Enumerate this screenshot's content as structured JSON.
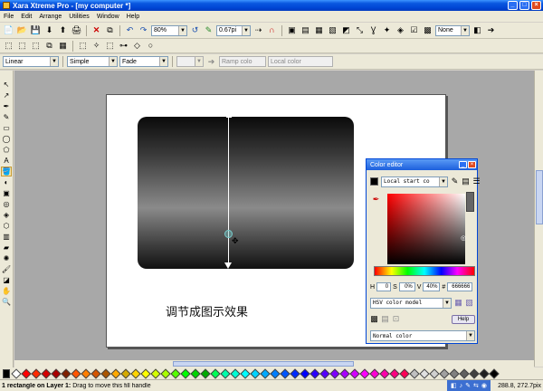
{
  "window": {
    "title": "Xara Xtreme Pro - [my computer *]"
  },
  "menu": {
    "items": [
      "File",
      "Edit",
      "Arrange",
      "Utilities",
      "Window",
      "Help"
    ]
  },
  "toolbar1": {
    "zoom_value": "80%",
    "line_width": "0.67pi",
    "line_style": "None"
  },
  "toolbar3": {
    "fill_type": "Linear",
    "fill_tiling": "Simple",
    "fill_effect": "Fade",
    "ramp_placeholder": "Ramp colo",
    "local_color_placeholder": "Local color"
  },
  "canvas": {
    "caption": "调节成图示效果"
  },
  "color_editor": {
    "title": "Color editor",
    "color_name": "Local start co",
    "h_value": "0",
    "s_value": "0%",
    "v_value": "40%",
    "hex_value": "666666",
    "model": "HSV color model",
    "help_label": "Help",
    "color_type": "Normal color",
    "labels": {
      "h": "H",
      "s": "S",
      "v": "V",
      "hash": "#"
    }
  },
  "palette": {
    "colors": [
      "#000000",
      "#ffffff",
      "#ff0000",
      "#ff2a00",
      "#d40000",
      "#aa0000",
      "#802000",
      "#ff5500",
      "#ff7f00",
      "#d45500",
      "#aa5500",
      "#ffaa00",
      "#d4aa00",
      "#ffd400",
      "#ffff00",
      "#d4ff00",
      "#aaff00",
      "#55ff00",
      "#00ff00",
      "#00d400",
      "#00aa00",
      "#00ff55",
      "#00ffaa",
      "#00ffd4",
      "#00ffff",
      "#00d4ff",
      "#00aaff",
      "#007fff",
      "#0055ff",
      "#002aff",
      "#0000ff",
      "#2a00ff",
      "#5500ff",
      "#7f00ff",
      "#aa00ff",
      "#d400ff",
      "#ff00ff",
      "#ff00d4",
      "#ff00aa",
      "#ff007f",
      "#ff0055",
      "#c0c0c0",
      "#e0e0e0",
      "#d0d0d0",
      "#a0a0a0",
      "#808080",
      "#606060",
      "#404040",
      "#202020",
      "#000000"
    ]
  },
  "status": {
    "message_bold": "1 rectangle on Layer 1:",
    "message": " Drag to move this fill handle",
    "coords": "288.8, 272.7pix"
  }
}
